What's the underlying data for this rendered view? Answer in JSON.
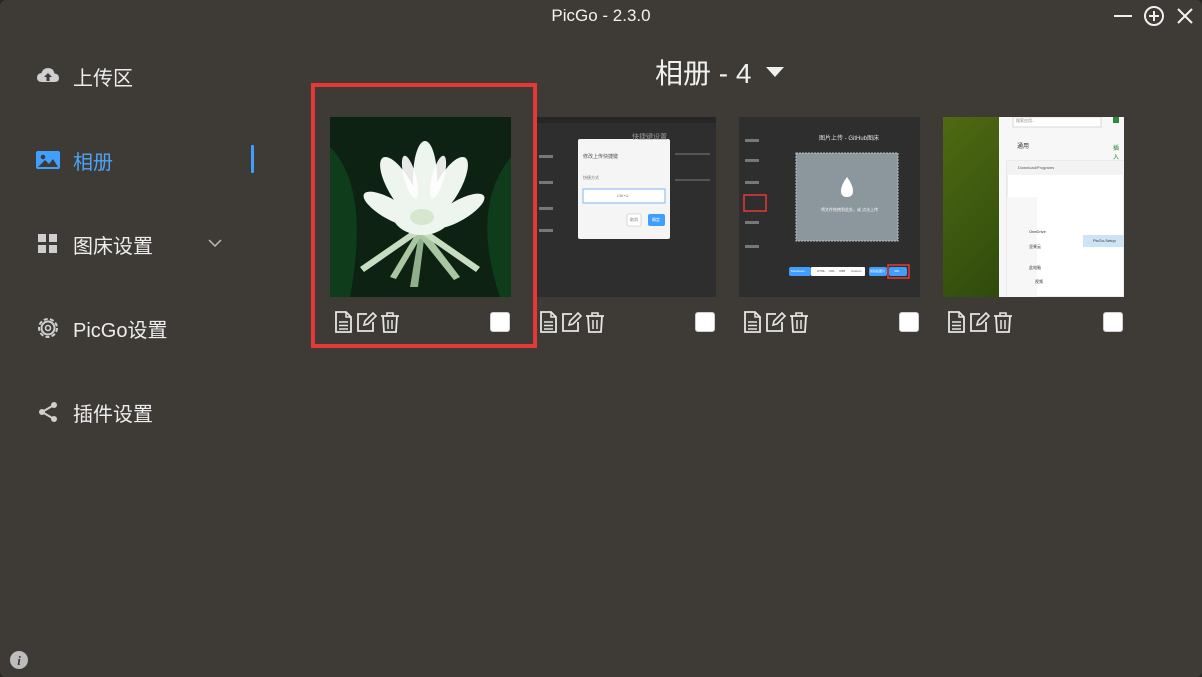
{
  "window": {
    "title": "PicGo - 2.3.0"
  },
  "sidebar": {
    "items": [
      {
        "label": "上传区"
      },
      {
        "label": "相册"
      },
      {
        "label": "图床设置"
      },
      {
        "label": "PicGo设置"
      },
      {
        "label": "插件设置"
      }
    ]
  },
  "gallery": {
    "title": "相册 - 4",
    "thumb2": {
      "dialog_title": "修改上传快捷键",
      "dialog_label": "快捷方式",
      "dialog_value": "Ctrl+U",
      "cancel": "取消",
      "confirm": "确定",
      "page_title": "快捷键设置"
    },
    "thumb3": {
      "heading": "图片上传 - GitHub图床",
      "drop_text": "将文件拖拽到此处，或 点击上传",
      "formats": [
        "Markdown",
        "HTML",
        "URL",
        "UBB",
        "Custom"
      ],
      "btn_clipboard": "剪贴板图片",
      "btn_url": "URL"
    },
    "thumb4": {
      "search": "搜索应用...",
      "general": "通用",
      "install": "插入",
      "path": "Download\\Programs",
      "tree": [
        "OneDrive",
        "坚果云",
        "此电脑",
        "视频"
      ],
      "file": "PicGo-Setup"
    }
  },
  "colors": {
    "accent": "#409eff",
    "window_bg": "#3e3b36",
    "highlight": "#e53935"
  }
}
